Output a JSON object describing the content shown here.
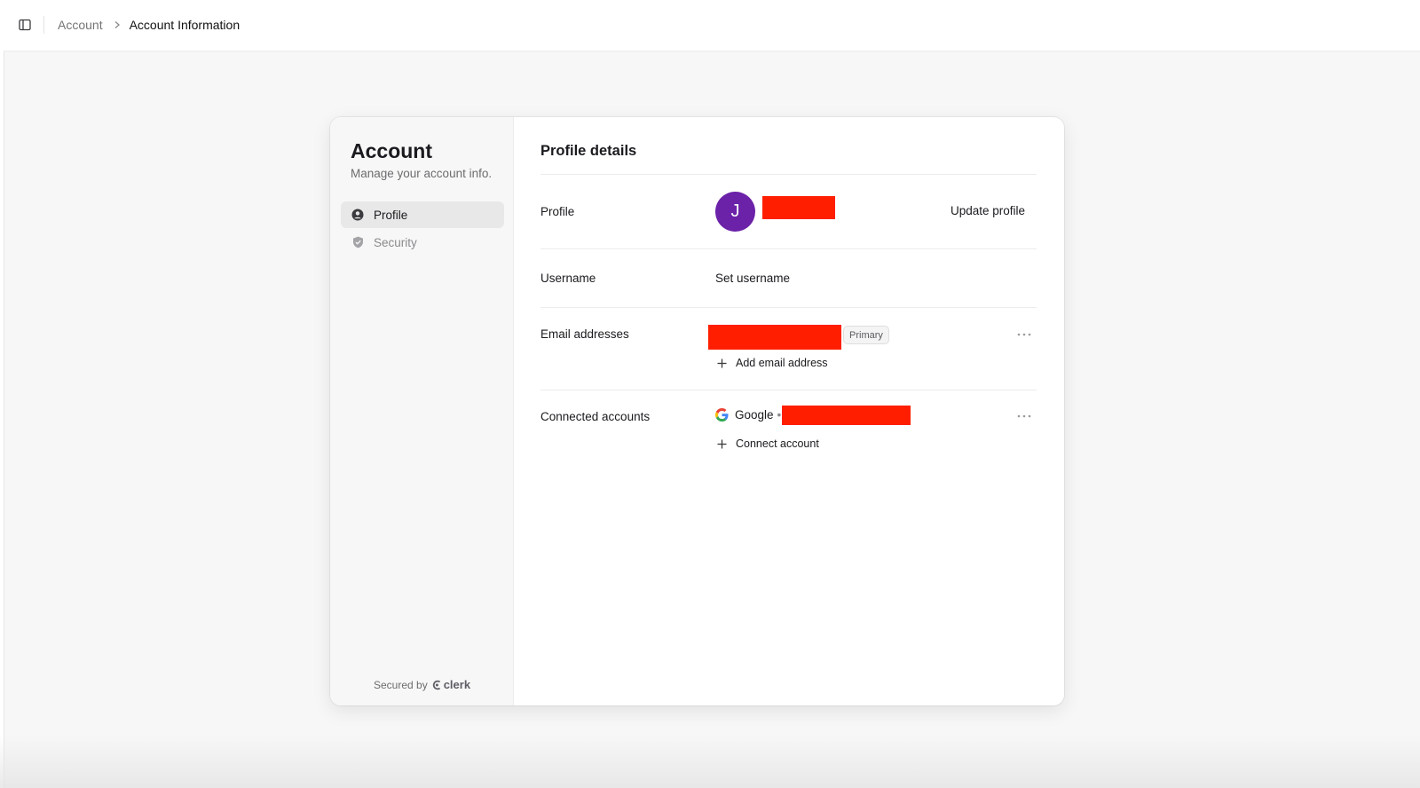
{
  "topbar": {
    "breadcrumb": {
      "parent": "Account",
      "current": "Account Information"
    }
  },
  "nav": {
    "title": "Account",
    "subtitle": "Manage your account info.",
    "items": [
      {
        "label": "Profile",
        "icon": "user-circle-icon",
        "active": true
      },
      {
        "label": "Security",
        "icon": "shield-check-icon",
        "active": false
      }
    ],
    "footer": {
      "secured_by": "Secured by",
      "brand": "clerk"
    }
  },
  "main": {
    "title": "Profile details",
    "profile": {
      "label": "Profile",
      "avatar_initial": "J",
      "avatar_color": "#6b21a8",
      "action": "Update profile"
    },
    "username": {
      "label": "Username",
      "action": "Set username"
    },
    "email": {
      "label": "Email addresses",
      "badge": "Primary",
      "add_action": "Add email address"
    },
    "connected": {
      "label": "Connected accounts",
      "provider": "Google",
      "separator": "•",
      "add_action": "Connect account"
    }
  },
  "colors": {
    "redaction": "#ff1f00",
    "accent_avatar": "#6b21a8"
  }
}
